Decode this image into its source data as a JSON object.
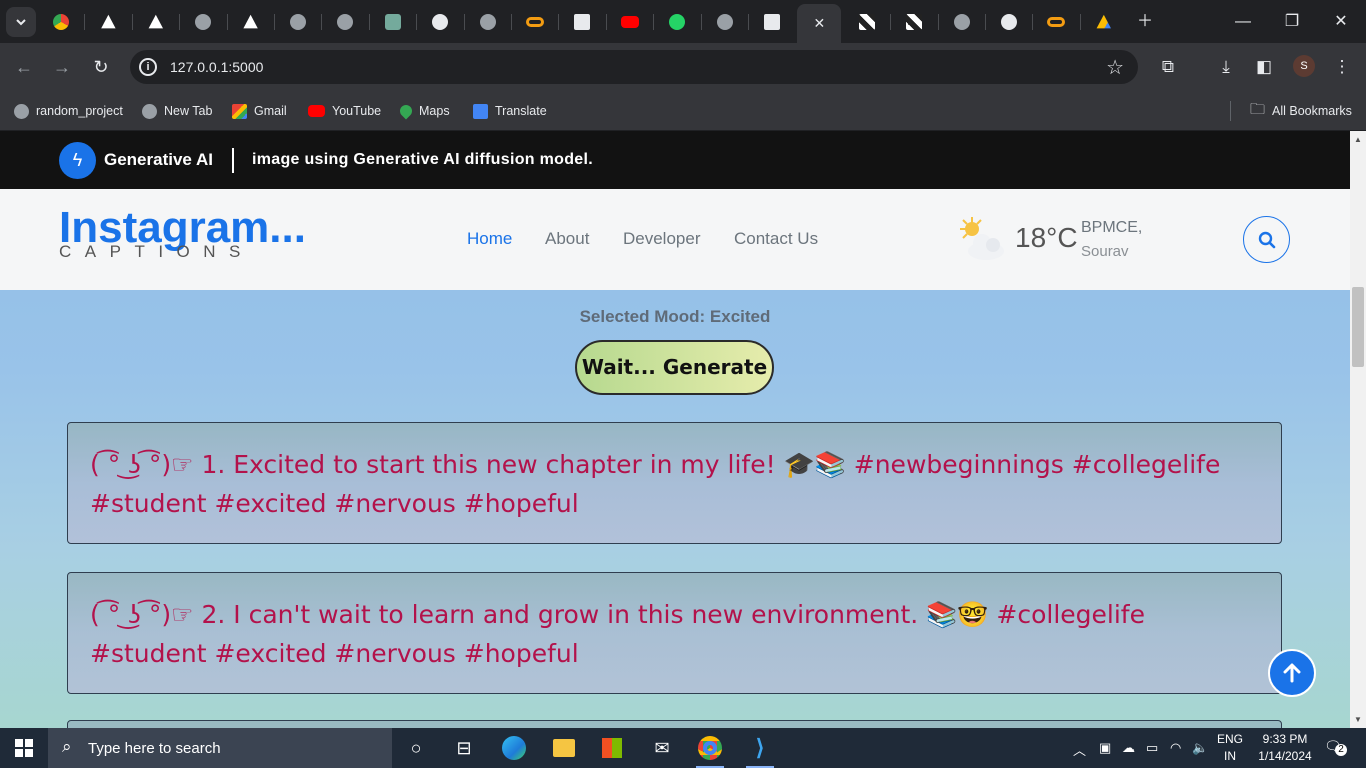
{
  "browser": {
    "tabs": [
      {
        "icon": "chrome-icon"
      },
      {
        "icon": "triangle-icon"
      },
      {
        "icon": "triangle-icon"
      },
      {
        "icon": "globe-icon"
      },
      {
        "icon": "triangle-icon"
      },
      {
        "icon": "globe-icon"
      },
      {
        "icon": "globe-icon"
      },
      {
        "icon": "chatgpt-icon"
      },
      {
        "icon": "github-icon"
      },
      {
        "icon": "globe-icon"
      },
      {
        "icon": "infinity-icon"
      },
      {
        "icon": "cube-icon"
      },
      {
        "icon": "youtube-icon"
      },
      {
        "icon": "whatsapp-icon"
      },
      {
        "icon": "globe-icon"
      },
      {
        "icon": "cube-icon"
      },
      {
        "icon": "close-icon",
        "active": true
      },
      {
        "icon": "pinwheel-icon"
      },
      {
        "icon": "pinwheel-icon"
      },
      {
        "icon": "globe-icon"
      },
      {
        "icon": "github-icon"
      },
      {
        "icon": "infinity-icon"
      },
      {
        "icon": "drive-icon"
      }
    ],
    "url": "127.0.0.1:5000",
    "profile_initial": "S",
    "bookmarks": [
      {
        "label": "random_project",
        "icon": "globe-icon"
      },
      {
        "label": "New Tab",
        "icon": "globe-icon"
      },
      {
        "label": "Gmail",
        "icon": "gmail-icon"
      },
      {
        "label": "YouTube",
        "icon": "youtube-icon"
      },
      {
        "label": "Maps",
        "icon": "maps-icon"
      },
      {
        "label": "Translate",
        "icon": "translate-icon"
      }
    ],
    "all_bookmarks": "All Bookmarks"
  },
  "site": {
    "topbar": {
      "brand": "Generative AI",
      "ticker": "image using Generative AI diffusion model."
    },
    "logo": {
      "title": "Instagram...",
      "subtitle": "CAPTIONS"
    },
    "nav": [
      {
        "label": "Home",
        "active": true
      },
      {
        "label": "About"
      },
      {
        "label": "Developer"
      },
      {
        "label": "Contact Us"
      }
    ],
    "weather": {
      "temp": "18°C",
      "location_line1": "BPMCE,",
      "location_line2": "Sourav"
    },
    "mood_label": "Selected Mood: Excited",
    "generate_button": "Wait... Generate",
    "captions": [
      "( ͡° ͜ʖ ͡°)☞ 1. Excited to start this new chapter in my life! 🎓📚 #newbeginnings #collegelife #student #excited #nervous #hopeful",
      "( ͡° ͜ʖ ͡°)☞ 2. I can't wait to learn and grow in this new environment. 📚🤓 #collegelife #student #excited #nervous #hopeful"
    ]
  },
  "taskbar": {
    "search_placeholder": "Type here to search",
    "lang_line1": "ENG",
    "lang_line2": "IN",
    "time": "9:33 PM",
    "date": "1/14/2024",
    "notifications": "2"
  },
  "colors": {
    "accent": "#1a73e8",
    "caption_text": "#b3124b",
    "topbar_bg": "#121212"
  }
}
